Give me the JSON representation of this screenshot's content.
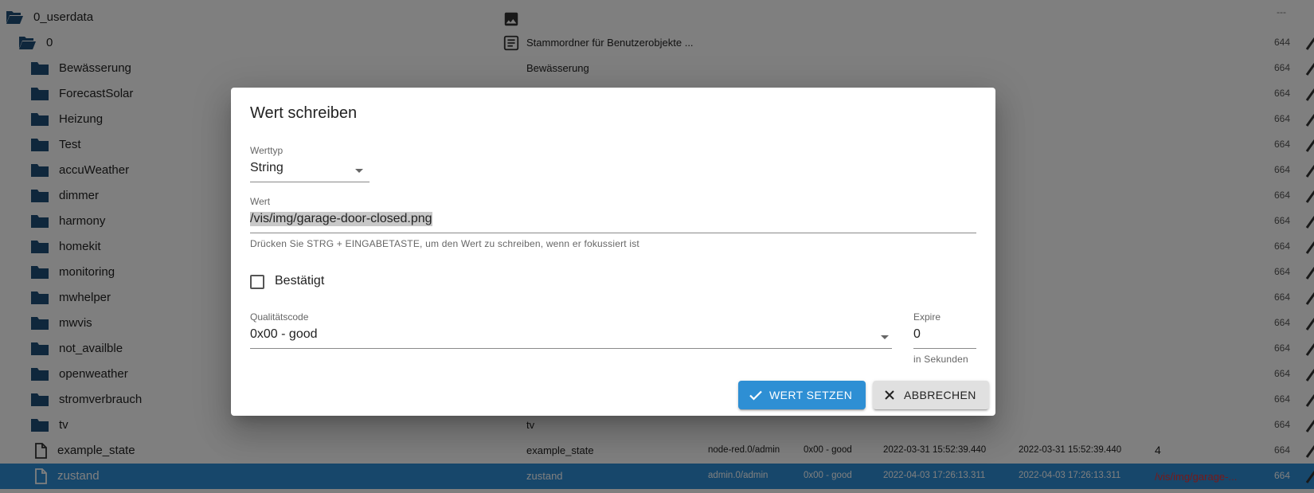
{
  "tree": {
    "top_dash": "---",
    "rows": [
      {
        "name": "0_userdata",
        "description": "",
        "acl": ""
      },
      {
        "name": "0",
        "description": "Stammordner für Benutzerobjekte ...",
        "acl": "644"
      },
      {
        "name": "Bewässerung",
        "description": "Bewässerung",
        "acl": "664"
      },
      {
        "name": "ForecastSolar",
        "description": "",
        "acl": "664"
      },
      {
        "name": "Heizung",
        "description": "",
        "acl": "664"
      },
      {
        "name": "Test",
        "description": "",
        "acl": "664"
      },
      {
        "name": "accuWeather",
        "description": "",
        "acl": "664"
      },
      {
        "name": "dimmer",
        "description": "",
        "acl": "664"
      },
      {
        "name": "harmony",
        "description": "",
        "acl": "664"
      },
      {
        "name": "homekit",
        "description": "",
        "acl": "664"
      },
      {
        "name": "monitoring",
        "description": "",
        "acl": "664"
      },
      {
        "name": "mwhelper",
        "description": "",
        "acl": "664"
      },
      {
        "name": "mwvis",
        "description": "",
        "acl": "664"
      },
      {
        "name": "not_availble",
        "description": "",
        "acl": "664"
      },
      {
        "name": "openweather",
        "description": "",
        "acl": "664"
      },
      {
        "name": "stromverbrauch",
        "description": "",
        "acl": "664"
      },
      {
        "name": "tv",
        "description": "tv",
        "acl": "664"
      },
      {
        "name": "example_state",
        "description": "example_state",
        "acl": "664",
        "from": "node-red.0/admin",
        "quality": "0x00 - good",
        "ts": "2022-03-31 15:52:39.440",
        "lc": "2022-03-31 15:52:39.440",
        "value": "4"
      },
      {
        "name": "zustand",
        "description": "zustand",
        "acl": "664",
        "from": "admin.0/admin",
        "quality": "0x00 - good",
        "ts": "2022-04-03 17:26:13.311",
        "lc": "2022-04-03 17:26:13.311",
        "value": "/vis/img/garage-..."
      }
    ]
  },
  "dialog": {
    "title": "Wert schreiben",
    "type_label": "Werttyp",
    "type_value": "String",
    "value_label": "Wert",
    "value": "/vis/img/garage-door-closed.png",
    "value_helper": "Drücken Sie STRG + EINGABETASTE, um den Wert zu schreiben, wenn er fokussiert ist",
    "ack_label": "Bestätigt",
    "ack_checked": false,
    "quality_label": "Qualitätscode",
    "quality_value": "0x00 - good",
    "expire_label": "Expire",
    "expire_value": "0",
    "expire_helper": "in Sekunden",
    "submit_label": "WERT SETZEN",
    "cancel_label": "ABBRECHEN"
  },
  "colors": {
    "folder": "#1f4e79",
    "primary": "#2e8fd4",
    "selected_row": "#2f8fd6",
    "value_red": "#e33333"
  },
  "icons": {
    "folder_open": "folder-open-icon",
    "folder": "folder-icon",
    "file": "file-icon",
    "image": "image-icon",
    "description": "description-icon",
    "edit": "pencil-icon",
    "submit": "check-icon",
    "cancel": "close-icon",
    "dropdown": "chevron-down-icon"
  }
}
